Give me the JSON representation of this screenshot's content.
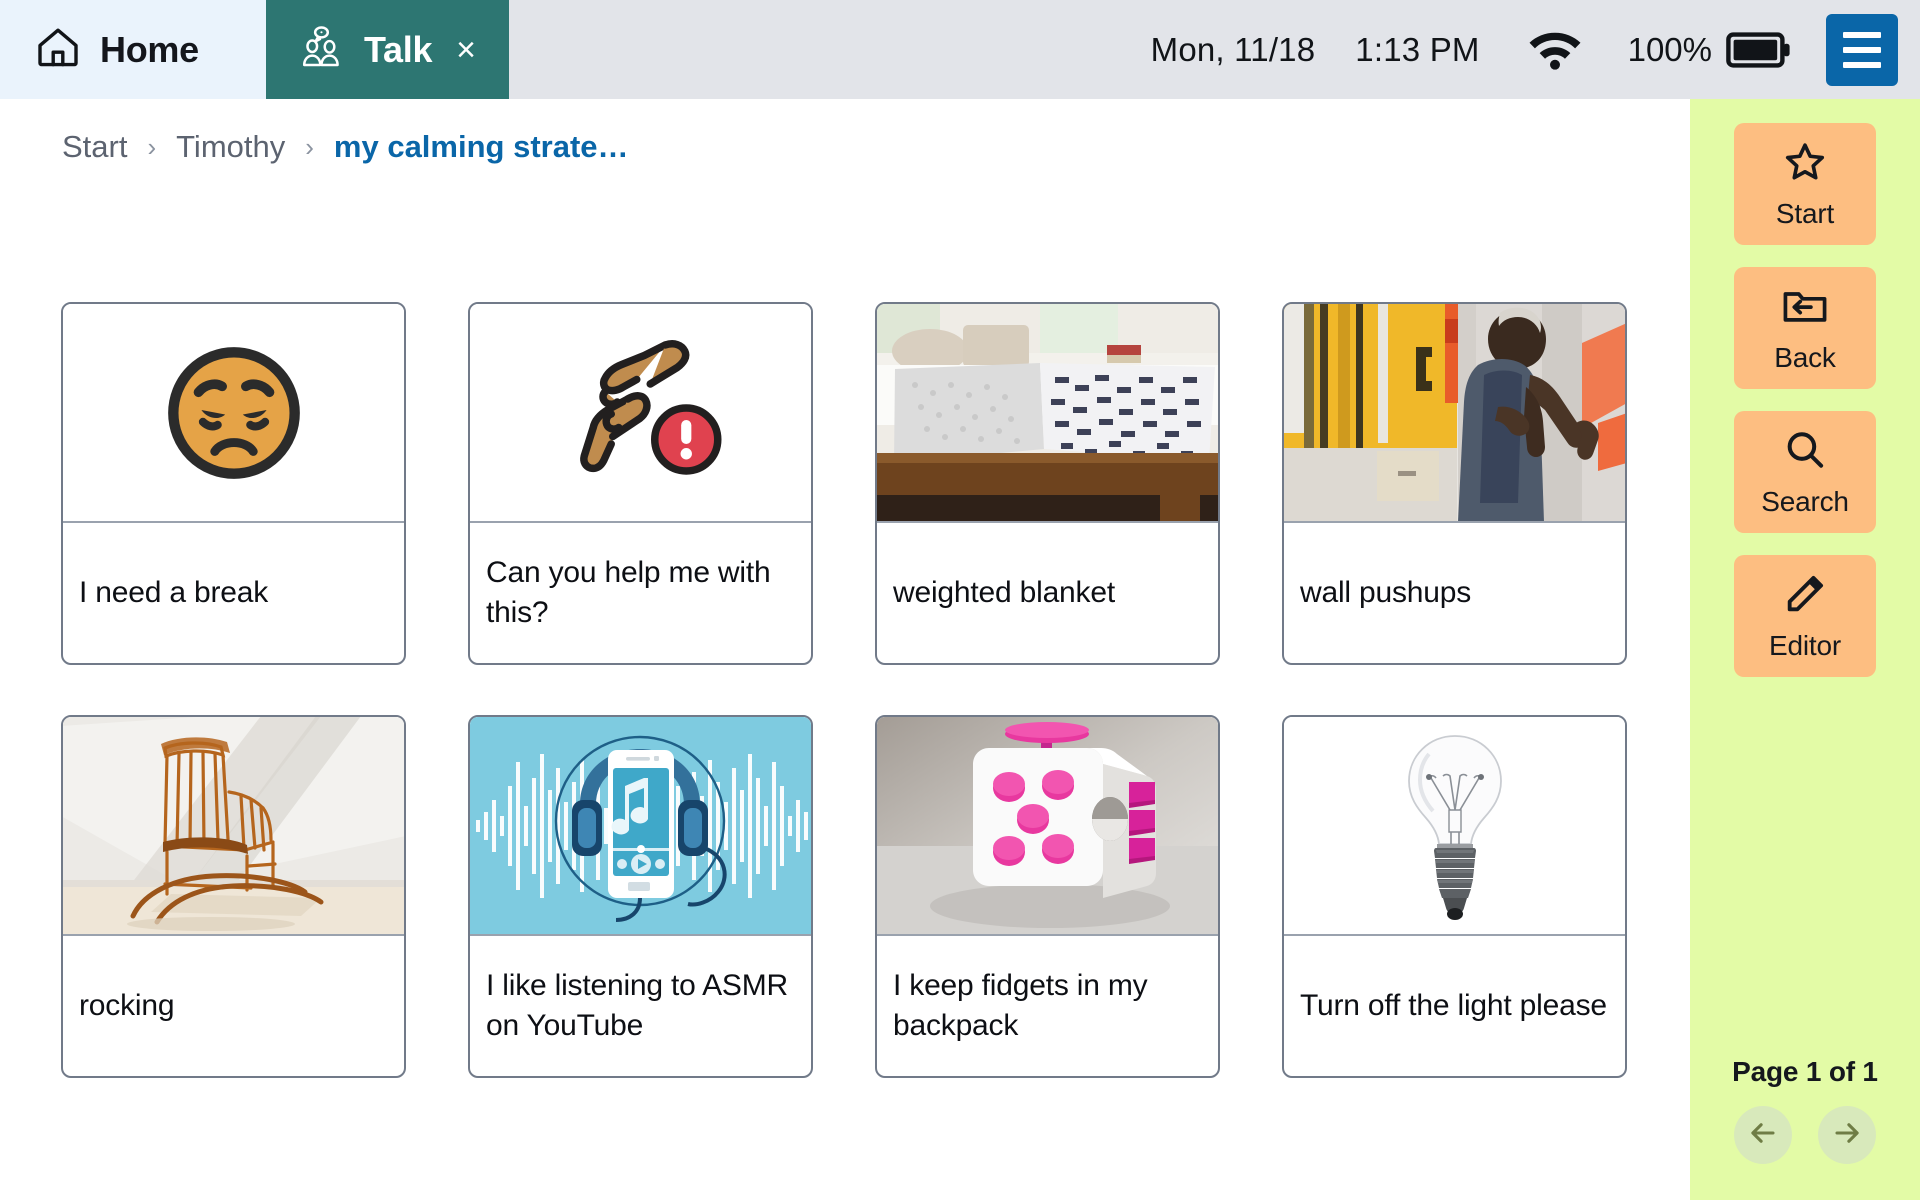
{
  "topbar": {
    "tabs": [
      {
        "label": "Home",
        "icon": "home-icon",
        "active": false
      },
      {
        "label": "Talk",
        "icon": "people-talking-icon",
        "active": true,
        "close": "×"
      }
    ],
    "status": {
      "date": "Mon, 11/18",
      "time": "1:13 PM",
      "wifi_icon": "wifi-icon",
      "battery_percent": "100%",
      "battery_icon": "battery-full-icon",
      "menu_icon": "hamburger-menu-icon"
    },
    "colors": {
      "bar_bg": "#e2e4e9",
      "home_tab_bg": "#eaf3fc",
      "talk_tab_bg": "#2d7672",
      "menu_btn_bg": "#0a66a8"
    }
  },
  "breadcrumb": {
    "separator": "›",
    "items": [
      {
        "label": "Start",
        "current": false
      },
      {
        "label": "Timothy",
        "current": false
      },
      {
        "label": "my calming strate…",
        "current": true
      }
    ],
    "current_color": "#0a66a8"
  },
  "board": {
    "cards": [
      {
        "label": "I need a break",
        "image": "sad-pensive-face-emoji"
      },
      {
        "label": "Can you help me with this?",
        "image": "helping-hands-with-alert-icon"
      },
      {
        "label": "weighted blanket",
        "image": "photo-weighted-blanket-on-bed"
      },
      {
        "label": "wall pushups",
        "image": "photo-man-doing-wall-pushups"
      },
      {
        "label": "rocking",
        "image": "photo-wooden-rocking-chair"
      },
      {
        "label": "I like listening to ASMR on YouTube",
        "image": "illustration-phone-headphones-music"
      },
      {
        "label": "I keep fidgets in my backpack",
        "image": "photo-white-pink-fidget-cube"
      },
      {
        "label": "Turn off the light please",
        "image": "photo-clear-light-bulb"
      }
    ]
  },
  "sidebar": {
    "buttons": [
      {
        "label": "Start",
        "icon": "star-icon"
      },
      {
        "label": "Back",
        "icon": "folder-back-arrow-icon"
      },
      {
        "label": "Search",
        "icon": "magnifier-icon"
      },
      {
        "label": "Editor",
        "icon": "pencil-icon"
      }
    ],
    "page_indicator": "Page 1 of 1",
    "prev_icon": "arrow-left-icon",
    "next_icon": "arrow-right-icon",
    "colors": {
      "bg": "#e3fba6",
      "button_bg": "#fdbe81",
      "pager_bg": "#d8e9bb"
    }
  }
}
